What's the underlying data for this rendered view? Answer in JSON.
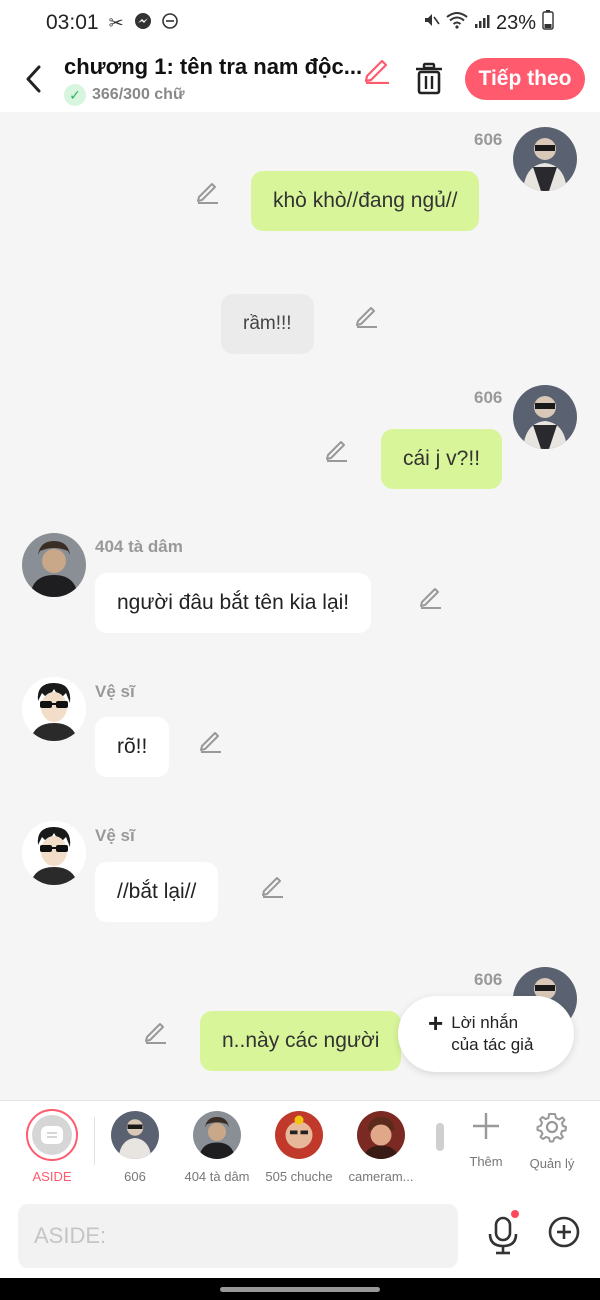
{
  "status_bar": {
    "time": "03:01",
    "battery": "23%"
  },
  "header": {
    "title": "chương 1: tên tra nam độc...",
    "word_count": "366/300 chữ",
    "next_label": "Tiếp theo",
    "accent_color": "#ff5a6e"
  },
  "messages": [
    {
      "sender": "606",
      "text": "khò khò//đang ngủ//",
      "side": "right"
    },
    {
      "text": "rầm!!!",
      "type": "narration"
    },
    {
      "sender": "606",
      "text": "cái j v?!!",
      "side": "right"
    },
    {
      "sender": "404 tà dâm",
      "text": "người đâu bắt tên kia lại!",
      "side": "left"
    },
    {
      "sender": "Vệ sĩ",
      "text": "rõ!!",
      "side": "left"
    },
    {
      "sender": "Vệ sĩ",
      "text": "//bắt lại//",
      "side": "left"
    },
    {
      "sender": "606",
      "text": "n..này các người",
      "side": "right"
    }
  ],
  "author_note": {
    "line1": "Lời nhắn",
    "line2": "của tác giả"
  },
  "characters": {
    "aside_label": "ASIDE",
    "list": [
      "606",
      "404 tà dâm",
      "505 chuche",
      "cameram..."
    ],
    "add_label": "Thêm",
    "manage_label": "Quản lý"
  },
  "input": {
    "placeholder": "ASIDE:"
  },
  "colors": {
    "green_bubble": "#d8f59a",
    "background": "#f5f5f5",
    "accent": "#ff5a6e"
  }
}
